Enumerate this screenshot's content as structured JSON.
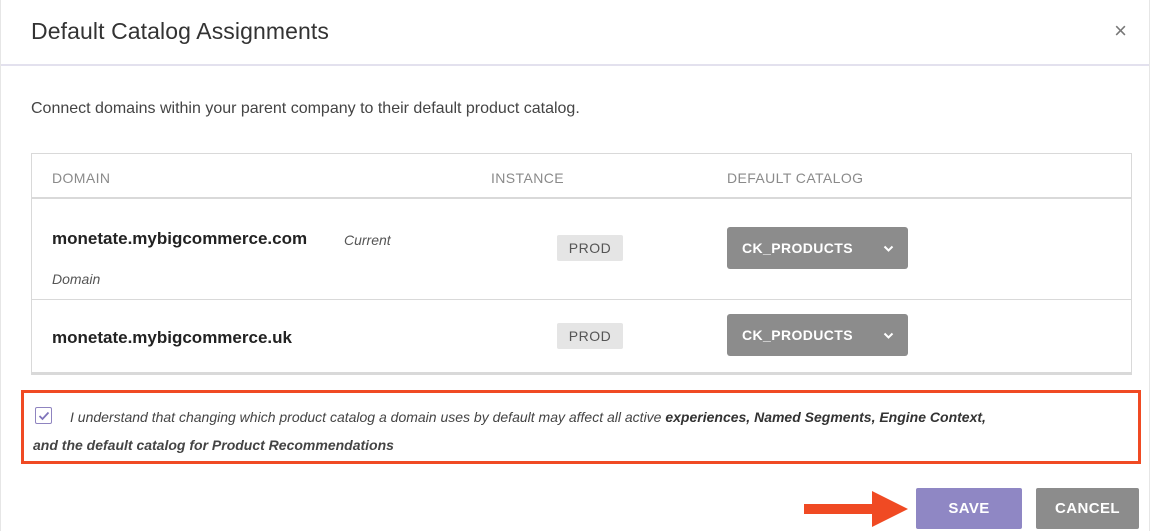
{
  "dialog": {
    "title": "Default Catalog Assignments",
    "close_glyph": "×",
    "description": "Connect domains within your parent company to their default product catalog."
  },
  "table": {
    "headers": [
      "DOMAIN",
      "INSTANCE",
      "DEFAULT CATALOG"
    ],
    "rows": [
      {
        "domain": "monetate.mybigcommerce.com",
        "note_part1": "Current",
        "note_part2": "Domain",
        "instance": "PROD",
        "catalog": "CK_PRODUCTS"
      },
      {
        "domain": "monetate.mybigcommerce.uk",
        "instance": "PROD",
        "catalog": "CK_PRODUCTS"
      }
    ]
  },
  "acknowledgement": {
    "checked": true,
    "text_plain": "I understand that changing which product catalog a domain uses by default may affect all active",
    "text_bold": "experiences, Named Segments, Engine Context,",
    "text_line2": "and the default catalog for Product Recommendations"
  },
  "buttons": {
    "save_label": "SAVE",
    "cancel_label": "CANCEL"
  },
  "icons": {
    "close": "close-icon",
    "chevron": "chevron-down-icon",
    "check": "check-icon",
    "arrow": "arrow-right-icon"
  },
  "colors": {
    "highlight_border": "#f04a23",
    "save_button": "#8f87c4",
    "neutral_button": "#8c8c8c",
    "badge_bg": "#e5e5e5"
  }
}
